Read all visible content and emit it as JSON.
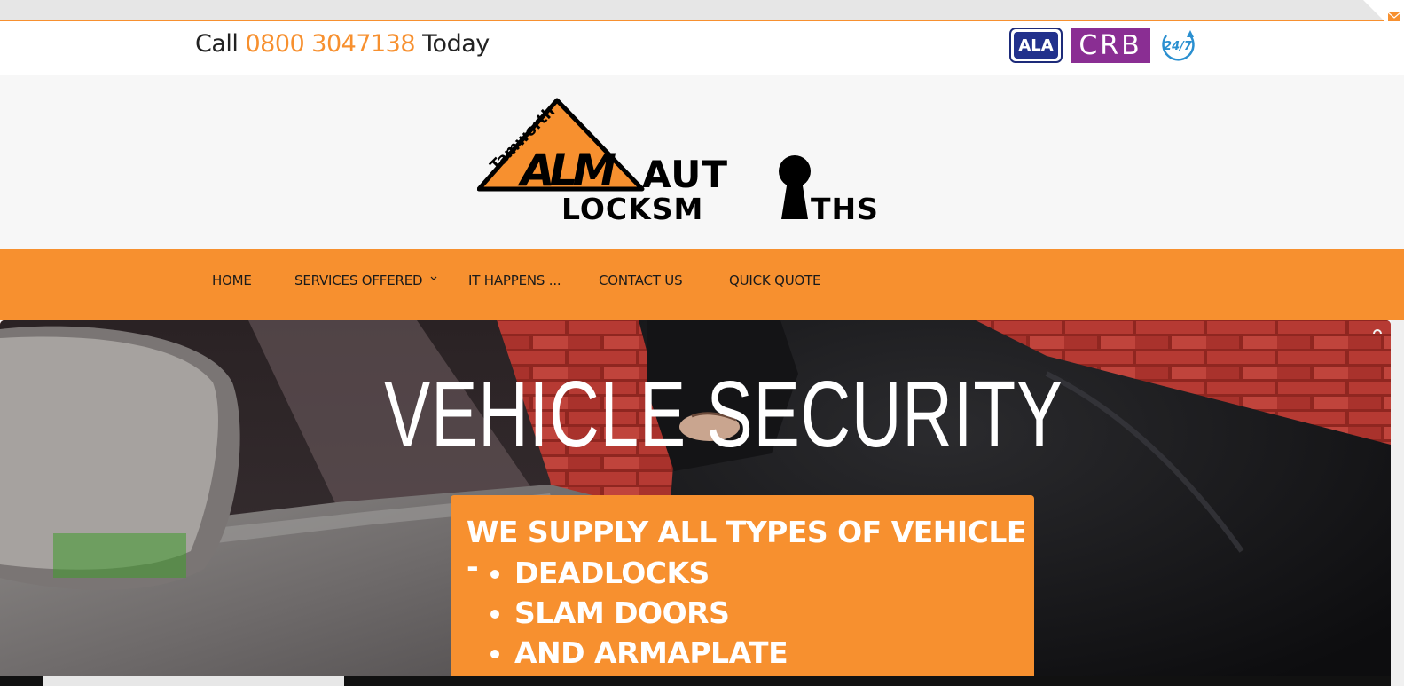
{
  "header": {
    "call_prefix": "Call",
    "phone": "0800 3047138",
    "call_suffix": "Today",
    "badges": {
      "ala": "ALA",
      "crb": "CRB",
      "always": "24/7"
    }
  },
  "logo": {
    "town": "Tamworth",
    "initials": "ALM",
    "line1": "AUT",
    "line2": "LOCKSM",
    "line2b": "THS"
  },
  "nav": {
    "items": [
      {
        "label": "HOME"
      },
      {
        "label": "SERVICES OFFERED",
        "has_dropdown": true
      },
      {
        "label": "IT HAPPENS ..."
      },
      {
        "label": "CONTACT US"
      },
      {
        "label": "QUICK QUOTE"
      }
    ]
  },
  "hero": {
    "title": "VEHICLE SECURITY",
    "promo_heading": "WE SUPPLY ALL TYPES OF VEHICLE -",
    "promo_items": [
      "DEADLOCKS",
      "SLAM DOORS",
      "AND ARMAPLATE"
    ]
  },
  "colors": {
    "brand_orange": "#f7902f",
    "text_dark": "#222222",
    "ala_blue": "#22318c",
    "crb_purple": "#8a2e93",
    "badge_247_blue": "#2a8fd0"
  },
  "icons": [
    "envelope-icon",
    "chevron-down-icon",
    "loading-spinner-icon"
  ]
}
